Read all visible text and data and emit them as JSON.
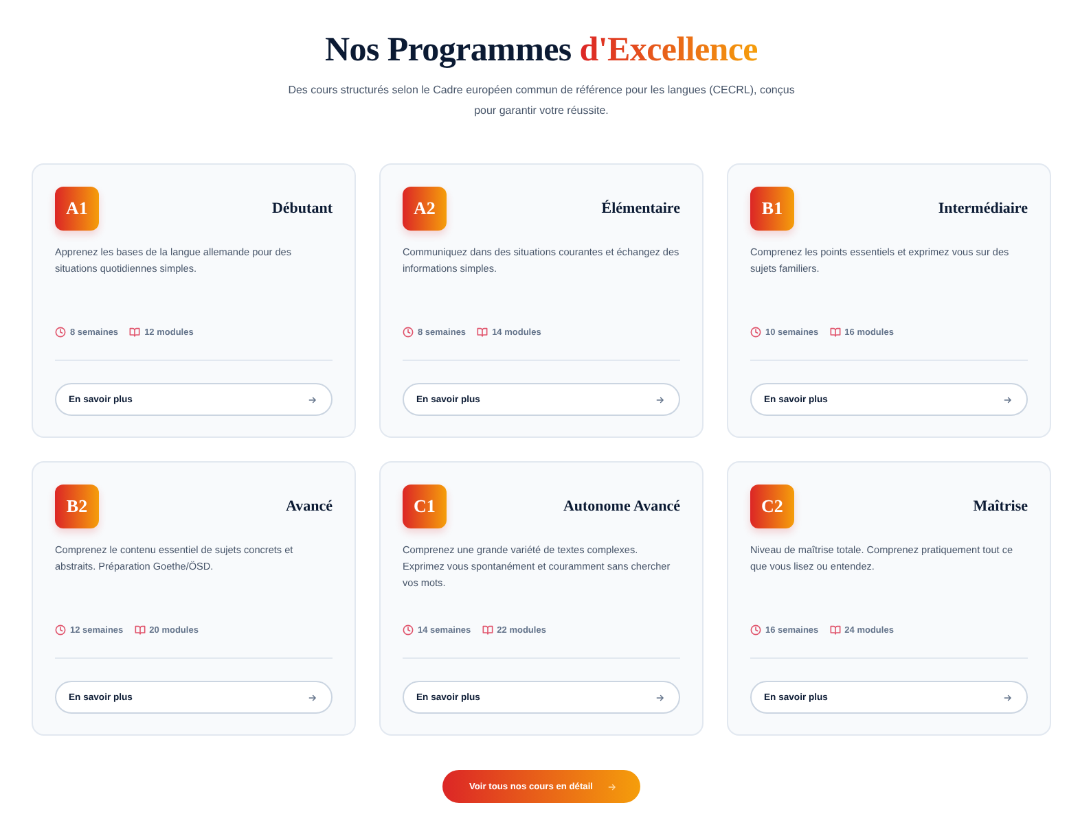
{
  "header": {
    "title": "Nos Programmes",
    "title_highlight": "d'Excellence",
    "subtitle": "Des cours structurés selon le Cadre européen commun de référence pour les langues (CECRL), conçus pour garantir votre réussite."
  },
  "programs": [
    {
      "badge": "A1",
      "name": "Débutant",
      "description": "Apprenez les bases de la langue allemande pour des situations quotidiennes simples.",
      "duration": "8 semaines",
      "modules": "12 modules",
      "button": "En savoir plus"
    },
    {
      "badge": "A2",
      "name": "Élémentaire",
      "description": "Communiquez dans des situations courantes et échangez des informations simples.",
      "duration": "8 semaines",
      "modules": "14 modules",
      "button": "En savoir plus"
    },
    {
      "badge": "B1",
      "name": "Intermédiaire",
      "description": "Comprenez les points essentiels et exprimez vous sur des sujets familiers.",
      "duration": "10 semaines",
      "modules": "16 modules",
      "button": "En savoir plus"
    },
    {
      "badge": "B2",
      "name": "Avancé",
      "description": "Comprenez le contenu essentiel de sujets concrets et abstraits. Préparation Goethe/ÖSD.",
      "duration": "12 semaines",
      "modules": "20 modules",
      "button": "En savoir plus"
    },
    {
      "badge": "C1",
      "name": "Autonome Avancé",
      "description": "Comprenez une grande variété de textes complexes. Exprimez vous spontanément et couramment sans chercher vos mots.",
      "duration": "14 semaines",
      "modules": "22 modules",
      "button": "En savoir plus"
    },
    {
      "badge": "C2",
      "name": "Maîtrise",
      "description": "Niveau de maîtrise totale. Comprenez pratiquement tout ce que vous lisez ou entendez.",
      "duration": "16 semaines",
      "modules": "24 modules",
      "button": "En savoir plus"
    }
  ],
  "cta": {
    "label": "Voir tous nos cours en détail"
  }
}
